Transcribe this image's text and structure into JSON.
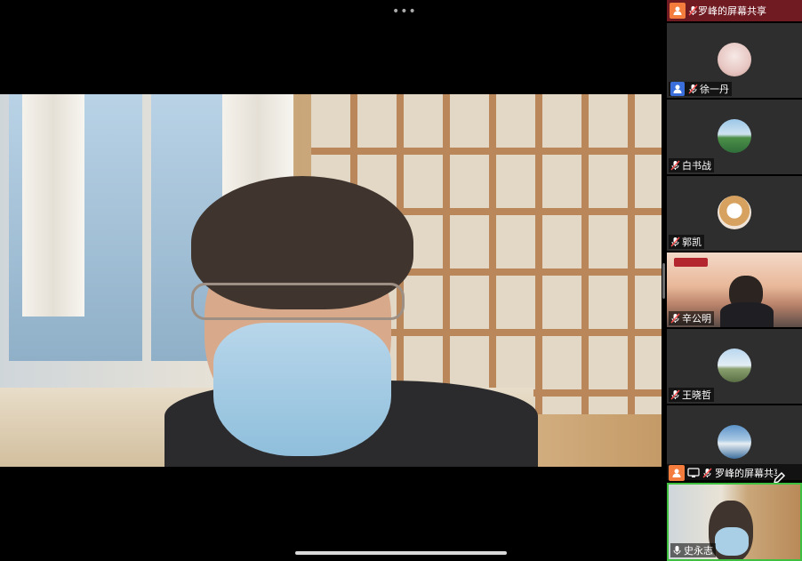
{
  "app": {
    "more_menu": "•••"
  },
  "share_banner": {
    "label": "罗峰的屏幕共享"
  },
  "participants": [
    {
      "name": "徐一丹",
      "avatar": "pink-blossom-photo"
    },
    {
      "name": "白书战",
      "avatar": "lake-photo"
    },
    {
      "name": "郭凯",
      "avatar": "dog-photo"
    },
    {
      "name": "辛公明",
      "avatar": "live-video"
    },
    {
      "name": "王晓哲",
      "avatar": "person-photo"
    },
    {
      "name": "",
      "avatar": "sky-photo"
    }
  ],
  "share_tile": {
    "label": "罗峰的屏幕共享"
  },
  "self_tile": {
    "name": "史永志"
  },
  "colors": {
    "share_header_bg": "#701a22",
    "accent_person": "#f47c3c",
    "active_border": "#3fbf3f"
  }
}
